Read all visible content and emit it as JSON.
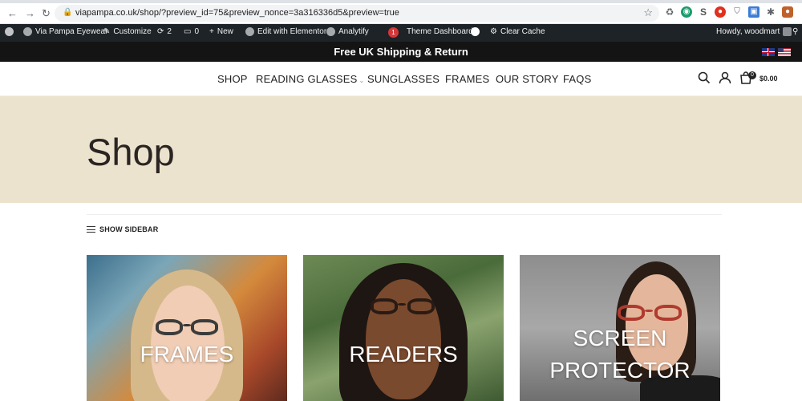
{
  "browser": {
    "url": "viapampa.co.uk/shop/?preview_id=75&preview_nonce=3a316336d5&preview=true",
    "extensions": [
      {
        "icon": "recycle-icon",
        "color": "#5f6368"
      },
      {
        "icon": "globe-icon",
        "color": "#1a9b6c"
      },
      {
        "icon": "s-extension-icon",
        "color": "#555555"
      },
      {
        "icon": "shield-red-icon",
        "color": "#e0301e"
      },
      {
        "icon": "shield-icon",
        "color": "#5f6368"
      },
      {
        "icon": "window-icon",
        "color": "#3a7bd5"
      },
      {
        "icon": "puzzle-icon",
        "color": "#5f6368"
      },
      {
        "icon": "profile-icon",
        "color": "#c0612b"
      }
    ]
  },
  "adminbar": {
    "site_name": "Via Pampa Eyewear",
    "customize": "Customize",
    "updates": "2",
    "comments": "0",
    "new": "New",
    "edit": "Edit with Elementor",
    "analytify": "Analytify",
    "notif_count": "1",
    "theme_dashboard": "Theme Dashboard",
    "clear_cache": "Clear Cache",
    "howdy": "Howdy, woodmart"
  },
  "promo": {
    "text": "Free UK Shipping & Return"
  },
  "nav": {
    "items": [
      "SHOP",
      "READING GLASSES",
      "SUNGLASSES",
      "FRAMES",
      "OUR STORY",
      "FAQS"
    ],
    "cart_count": "0",
    "cart_total": "$0.00"
  },
  "page": {
    "title": "Shop",
    "show_sidebar": "SHOW SIDEBAR"
  },
  "categories": [
    {
      "label": "FRAMES"
    },
    {
      "label": "READERS"
    },
    {
      "label": "SCREEN PROTECTOR"
    }
  ],
  "colors": {
    "banner_bg": "#ebe3cd",
    "promo_bg": "#141414",
    "adminbar_bg": "#1d2327"
  }
}
